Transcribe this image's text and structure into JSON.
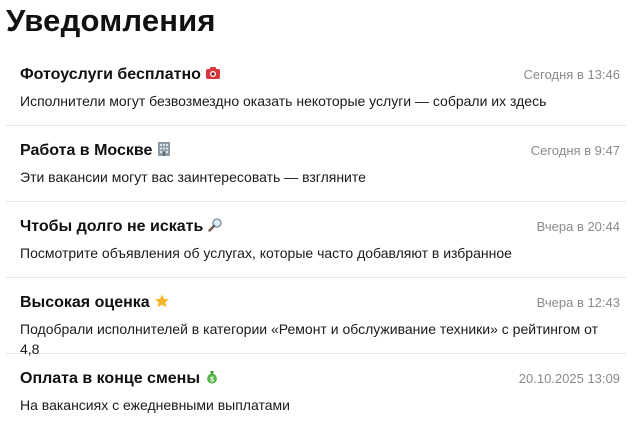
{
  "page": {
    "title": "Уведомления"
  },
  "notifications": [
    {
      "title": "Фотоуслуги бесплатно",
      "icon": "camera-emoji-icon",
      "time": "Сегодня в 13:46",
      "text": "Исполнители могут безвозмездно оказать некоторые услуги — собрали их здесь"
    },
    {
      "title": "Работа в Москве",
      "icon": "office-building-emoji-icon",
      "time": "Сегодня в 9:47",
      "text": "Эти вакансии могут вас заинтересовать — взгляните"
    },
    {
      "title": "Чтобы долго не искать",
      "icon": "magnifier-emoji-icon",
      "time": "Вчера в 20:44",
      "text": "Посмотрите объявления об услугах, которые часто добавляют в избранное"
    },
    {
      "title": "Высокая оценка",
      "icon": "star-emoji-icon",
      "time": "Вчера в 12:43",
      "text": "Подобрали исполнителей в категории «Ремонт и обслуживание техники» с рейтингом от 4,8"
    },
    {
      "title": "Оплата в конце смены",
      "icon": "money-bag-emoji-icon",
      "time": "20.10.2025 13:09",
      "text": "На вакансиях с ежедневными выплатами"
    }
  ],
  "colors": {
    "title_text": "#111111",
    "timestamp_text": "#8a8a8a",
    "divider": "#e6e6e6",
    "background": "#ffffff"
  }
}
